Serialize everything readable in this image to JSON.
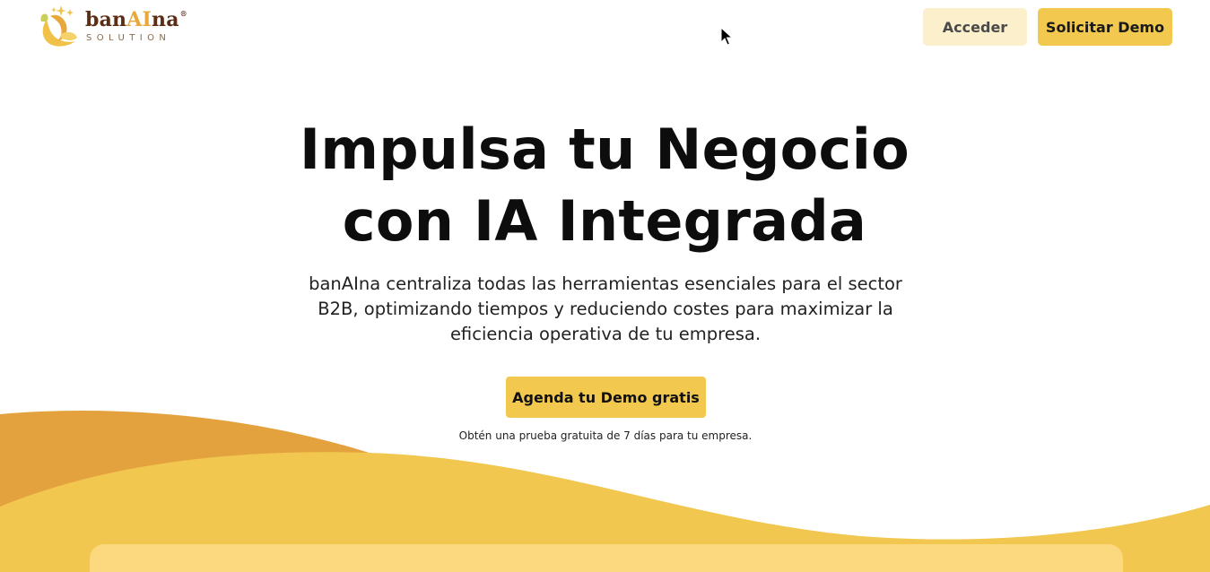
{
  "header": {
    "logo": {
      "word_prefix": "ban",
      "word_highlight": "AI",
      "word_suffix": "na",
      "registered_mark": "®",
      "tagline": "SOLUTION",
      "icon": "banana-sparkle-logo"
    },
    "login_label": "Acceder",
    "demo_label": "Solicitar Demo"
  },
  "hero": {
    "title_line1": "Impulsa tu Negocio",
    "title_line2": "con IA Integrada",
    "subtitle": "banAIna centraliza todas las herramientas esenciales para el sector B2B, optimizando tiempos y reduciendo costes para maximizar la eficiencia operativa de tu empresa.",
    "cta_label": "Agenda tu Demo gratis",
    "cta_note": "Obtén una prueba gratuita de 7 días para tu empresa."
  },
  "colors": {
    "accent": "#f2c84f",
    "accent_light": "#fcefcb",
    "wave_orange": "#e4a23f",
    "wave_yellow": "#f1c74f",
    "panel": "#fcd97f",
    "brand_brown": "#5a2d14"
  }
}
